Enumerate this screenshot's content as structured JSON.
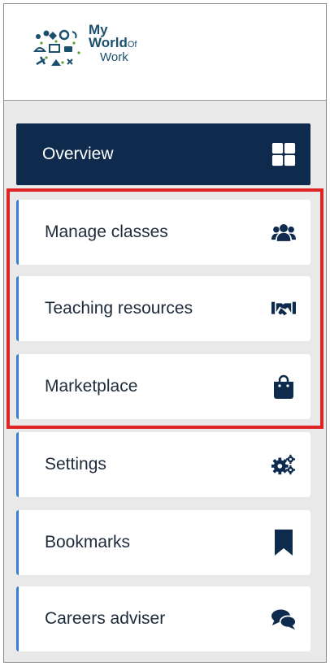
{
  "logo": {
    "line1": "My",
    "line2": "World",
    "of": "Of",
    "line3": "Work"
  },
  "nav": {
    "items": [
      {
        "label": "Overview",
        "icon": "grid-icon",
        "active": true
      },
      {
        "label": "Manage classes",
        "icon": "users-icon"
      },
      {
        "label": "Teaching resources",
        "icon": "handshake-icon"
      },
      {
        "label": "Marketplace",
        "icon": "shopping-bag-icon"
      },
      {
        "label": "Settings",
        "icon": "gears-icon"
      },
      {
        "label": "Bookmarks",
        "icon": "bookmark-icon"
      },
      {
        "label": "Careers adviser",
        "icon": "chat-bubbles-icon"
      }
    ]
  },
  "colors": {
    "active_bg": "#0e2a4c",
    "accent": "#3a7bd5",
    "highlight": "#e02424",
    "icon": "#0e2a4c"
  }
}
